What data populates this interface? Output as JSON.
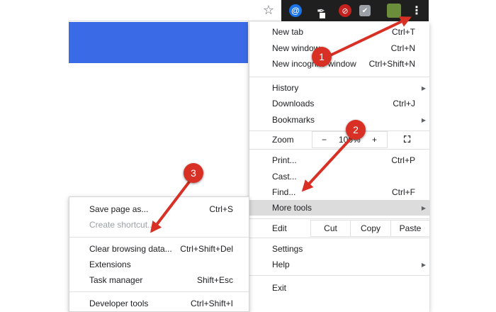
{
  "toolbar": {
    "star": "☆",
    "ext_at": "@",
    "ext_pen": "✒",
    "ext_red": "⊘",
    "ext_gray": "✔",
    "kebab": "⋮",
    "icons": [
      "star-icon",
      "at-extension-icon",
      "pen-extension-icon",
      "blocked-extension-icon",
      "check-extension-icon",
      "profile-avatar-icon",
      "more-menu-icon"
    ]
  },
  "menu": {
    "new_tab": {
      "label": "New tab",
      "shortcut": "Ctrl+T"
    },
    "new_window": {
      "label": "New window",
      "shortcut": "Ctrl+N"
    },
    "new_incognito": {
      "label": "New incognito window",
      "shortcut": "Ctrl+Shift+N"
    },
    "history": {
      "label": "History",
      "arrow": "▶"
    },
    "downloads": {
      "label": "Downloads",
      "shortcut": "Ctrl+J"
    },
    "bookmarks": {
      "label": "Bookmarks",
      "arrow": "▶"
    },
    "zoom": {
      "label": "Zoom",
      "minus": "−",
      "value": "100%",
      "plus": "+",
      "fullscreen": "⛶"
    },
    "print": {
      "label": "Print...",
      "shortcut": "Ctrl+P"
    },
    "cast": {
      "label": "Cast..."
    },
    "find": {
      "label": "Find...",
      "shortcut": "Ctrl+F"
    },
    "more_tools": {
      "label": "More tools",
      "arrow": "▶"
    },
    "edit": {
      "label": "Edit",
      "cut": "Cut",
      "copy": "Copy",
      "paste": "Paste"
    },
    "settings": {
      "label": "Settings"
    },
    "help": {
      "label": "Help",
      "arrow": "▶"
    },
    "exit": {
      "label": "Exit"
    }
  },
  "submenu": {
    "save_page": {
      "label": "Save page as...",
      "shortcut": "Ctrl+S"
    },
    "create_shortcut": {
      "label": "Create shortcut..."
    },
    "clear_data": {
      "label": "Clear browsing data...",
      "shortcut": "Ctrl+Shift+Del"
    },
    "extensions": {
      "label": "Extensions"
    },
    "task_manager": {
      "label": "Task manager",
      "shortcut": "Shift+Esc"
    },
    "developer_tools": {
      "label": "Developer tools",
      "shortcut": "Ctrl+Shift+I"
    }
  },
  "annotations": {
    "step1": "1",
    "step2": "2",
    "step3": "3",
    "color": "#d93025"
  }
}
